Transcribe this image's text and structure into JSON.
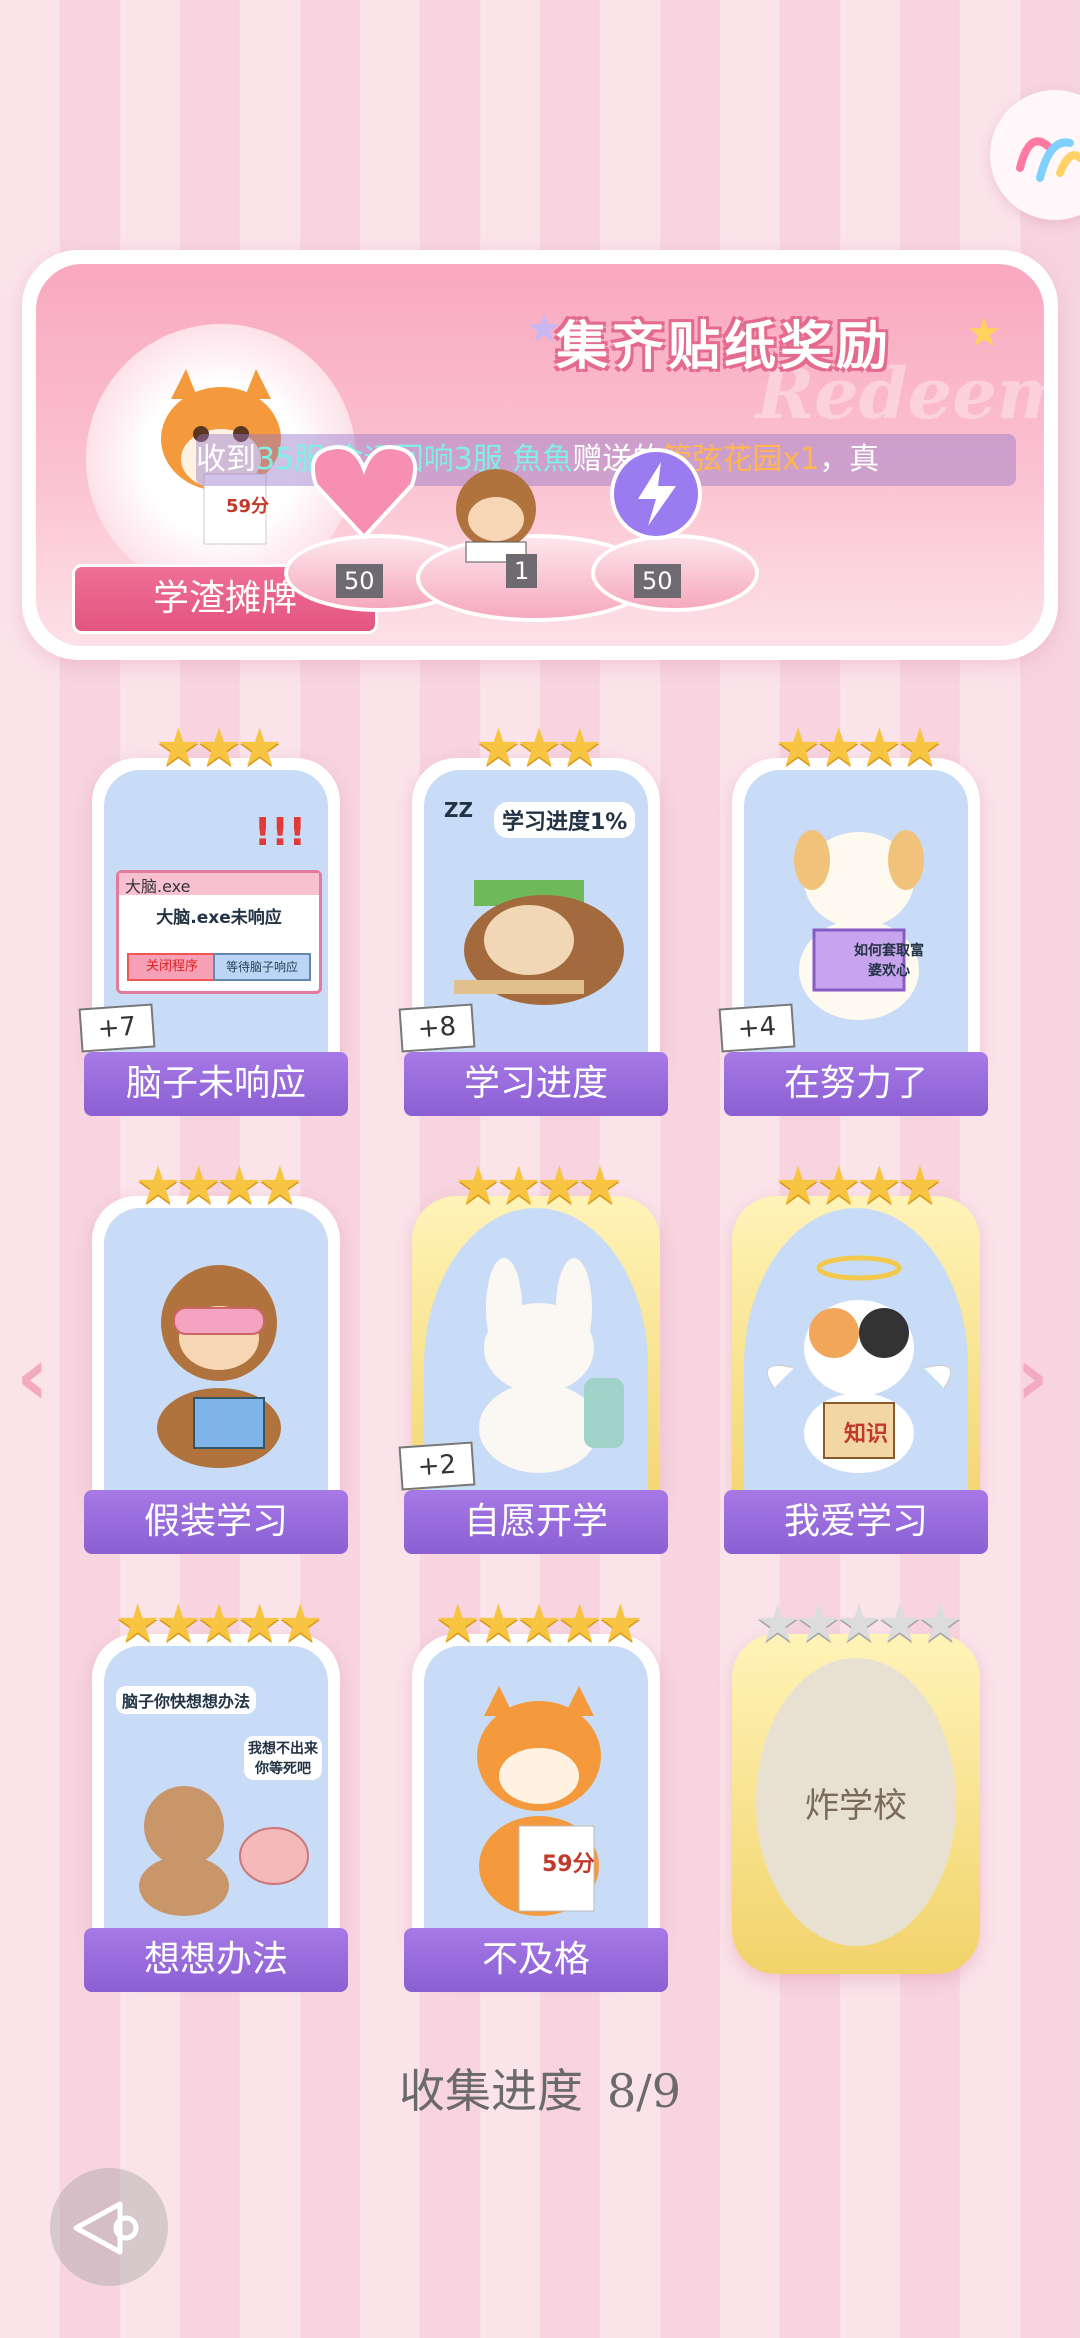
{
  "banner": {
    "title": "集齐贴纸奖励",
    "ghost_text": "Redeem",
    "marquee": {
      "prefix": "收到",
      "user": "35服 命运回响3服 魚魚",
      "middle": "赠送的",
      "gift": "管弦花园x1",
      "suffix": "，真"
    },
    "badge_label": "学渣摊牌",
    "badge_paper": "59分",
    "rewards": [
      {
        "name": "heart-gem",
        "count": "50"
      },
      {
        "name": "monkey-reading",
        "count": "1"
      },
      {
        "name": "energy-orb",
        "count": "50"
      }
    ]
  },
  "cards": [
    {
      "label": "脑子未响应",
      "stars": 3,
      "plus": "+7",
      "art_text": "大脑.exe未响应",
      "btn1": "关闭程序",
      "btn2": "等待脑子响应",
      "window_title": "大脑.exe",
      "marks": "!!!"
    },
    {
      "label": "学习进度",
      "stars": 3,
      "plus": "+8",
      "art_text": "学习进度1%",
      "zz": "ZZ"
    },
    {
      "label": "在努力了",
      "stars": 4,
      "plus": "+4",
      "art_text": "如何套取富婆欢心"
    },
    {
      "label": "假装学习",
      "stars": 4
    },
    {
      "label": "自愿开学",
      "stars": 4,
      "plus": "+2"
    },
    {
      "label": "我爱学习",
      "stars": 4,
      "art_text": "知识"
    },
    {
      "label": "想想办法",
      "stars": 5,
      "art_text": "脑子你快想想办法",
      "art_text2": "我想不出来你等死吧"
    },
    {
      "label": "不及格",
      "stars": 5,
      "art_text": "59分"
    },
    {
      "label": "炸学校",
      "stars": 5,
      "locked": true
    }
  ],
  "progress": {
    "label": "收集进度",
    "value": "8/9"
  },
  "colors": {
    "accent": "#8b5fd3",
    "pink": "#e25580",
    "star": "#f8c542"
  }
}
